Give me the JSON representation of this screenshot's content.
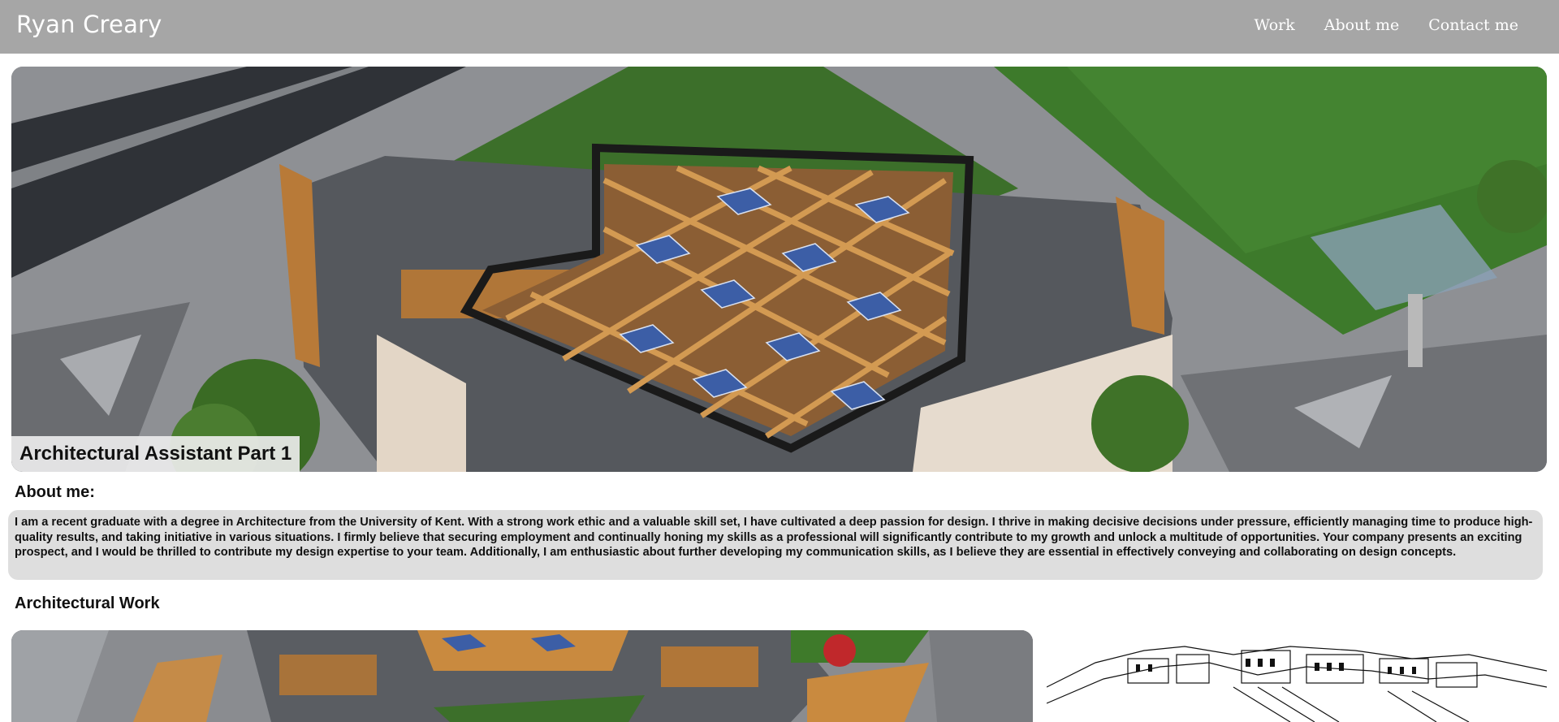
{
  "header": {
    "brand": "Ryan Creary",
    "nav": [
      {
        "label": "Work"
      },
      {
        "label": "About me"
      },
      {
        "label": "Contact me"
      }
    ]
  },
  "hero": {
    "caption": "Architectural Assistant Part 1"
  },
  "about": {
    "title": "About me:",
    "text": "I am a recent graduate with a degree in Architecture from the University of Kent. With a strong work ethic and a valuable skill set, I have cultivated a deep passion for design. I thrive in making decisive decisions under pressure, efficiently managing time to produce high-quality results, and taking initiative in various situations. I firmly believe that securing employment and continually honing my skills as a professional will significantly contribute to my growth and unlock a multitude of opportunities. Your company presents an exciting prospect, and I would be thrilled to contribute my design expertise to your team. Additionally, I am enthusiastic about further developing my communication skills, as I believe they are essential in effectively conveying and collaborating on design concepts."
  },
  "work": {
    "title": "Architectural Work"
  },
  "colors": {
    "header_bg": "#a6a6a6",
    "about_bg": "#dedede",
    "timber": "#c98a3f",
    "grass": "#3f7a2a",
    "solar": "#3c5ea6"
  }
}
